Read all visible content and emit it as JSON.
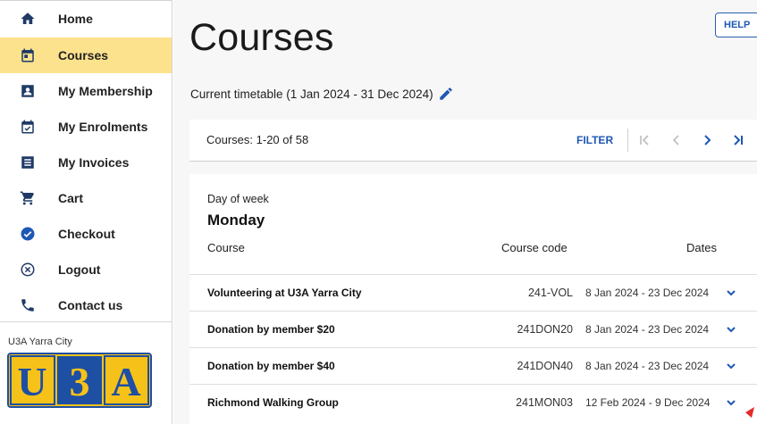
{
  "sidebar": {
    "items": [
      {
        "label": "Home",
        "icon": "home-icon"
      },
      {
        "label": "Courses",
        "icon": "calendar-icon"
      },
      {
        "label": "My Membership",
        "icon": "badge-icon"
      },
      {
        "label": "My Enrolments",
        "icon": "calendar-check-icon"
      },
      {
        "label": "My Invoices",
        "icon": "invoice-icon"
      },
      {
        "label": "Cart",
        "icon": "cart-icon"
      },
      {
        "label": "Checkout",
        "icon": "check-circle-icon"
      },
      {
        "label": "Logout",
        "icon": "cancel-circle-icon"
      },
      {
        "label": "Contact us",
        "icon": "phone-icon"
      }
    ],
    "org_name": "U3A Yarra City",
    "logo_text": "U3A"
  },
  "main": {
    "title": "Courses",
    "help_label": "HELP",
    "timetable": "Current timetable (1 Jan 2024 - 31 Dec 2024)",
    "pager": {
      "count_text": "Courses: 1-20 of 58",
      "filter_label": "FILTER"
    },
    "group": {
      "label": "Day of week",
      "value": "Monday"
    },
    "columns": {
      "course": "Course",
      "code": "Course code",
      "dates": "Dates"
    },
    "rows": [
      {
        "name": "Volunteering at U3A Yarra City",
        "code": "241-VOL",
        "dates": "8 Jan 2024 - 23 Dec 2024"
      },
      {
        "name": "Donation by member $20",
        "code": "241DON20",
        "dates": "8 Jan 2024 - 23 Dec 2024"
      },
      {
        "name": "Donation by member $40",
        "code": "241DON40",
        "dates": "8 Jan 2024 - 23 Dec 2024"
      },
      {
        "name": "Richmond Walking Group",
        "code": "241MON03",
        "dates": "12 Feb 2024 - 9 Dec 2024"
      }
    ]
  },
  "colors": {
    "accent": "#1e58b4",
    "active_nav": "#fde28d",
    "logo_blue": "#1d4fa3",
    "logo_gold": "#f6c21a"
  }
}
